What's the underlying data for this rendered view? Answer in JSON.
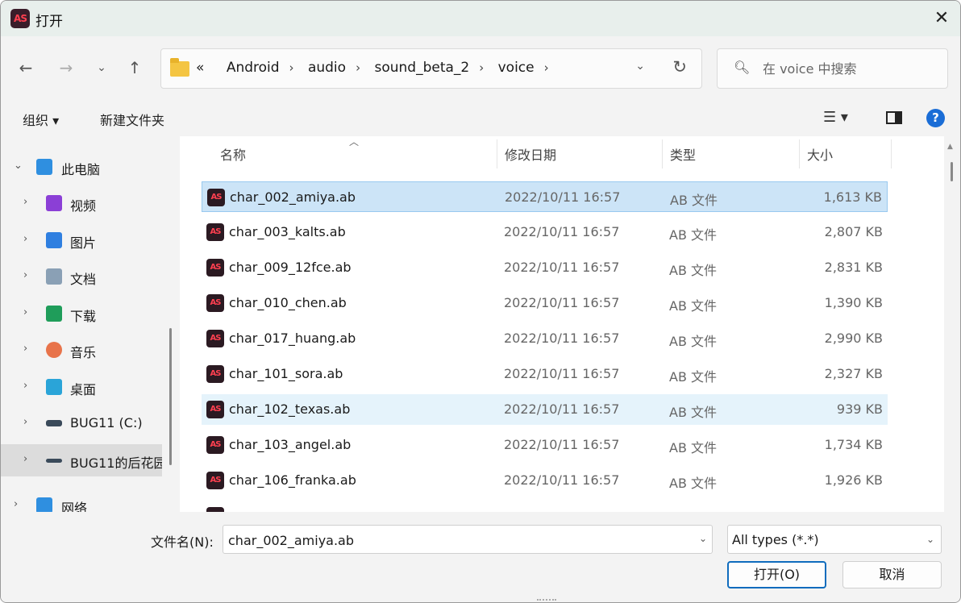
{
  "window": {
    "title": "打开",
    "app_icon_text": "AS",
    "close_glyph": "✕"
  },
  "address": {
    "crumbs": [
      "Android",
      "audio",
      "sound_beta_2",
      "voice"
    ],
    "overflow": "«",
    "separator": "›"
  },
  "search": {
    "placeholder": "在 voice 中搜索"
  },
  "toolbar": {
    "organize": "组织 ▾",
    "new_folder": "新建文件夹"
  },
  "sidebar": {
    "items": [
      {
        "label": "此电脑",
        "icon": "pc-icon",
        "color": "#2f8fe0"
      },
      {
        "label": "视频",
        "icon": "video-icon",
        "color": "#8b3fd6"
      },
      {
        "label": "图片",
        "icon": "pictures-icon",
        "color": "#2f7fe0"
      },
      {
        "label": "文档",
        "icon": "documents-icon",
        "color": "#8aa0b5"
      },
      {
        "label": "下载",
        "icon": "downloads-icon",
        "color": "#1f9d5a"
      },
      {
        "label": "音乐",
        "icon": "music-icon",
        "color": "#e8734a"
      },
      {
        "label": "桌面",
        "icon": "desktop-icon",
        "color": "#2aa4d8"
      },
      {
        "label": "BUG11 (C:)",
        "icon": "drive-icon",
        "color": "#3a4a5a"
      },
      {
        "label": "BUG11的后花园",
        "icon": "drive-icon",
        "color": "#3a4a5a"
      },
      {
        "label": "网络",
        "icon": "network-icon",
        "color": "#2f8fe0"
      }
    ]
  },
  "columns": {
    "name": "名称",
    "date": "修改日期",
    "type": "类型",
    "size": "大小"
  },
  "files": [
    {
      "name": "char_002_amiya.ab",
      "date": "2022/10/11 16:57",
      "type": "AB 文件",
      "size": "1,613 KB"
    },
    {
      "name": "char_003_kalts.ab",
      "date": "2022/10/11 16:57",
      "type": "AB 文件",
      "size": "2,807 KB"
    },
    {
      "name": "char_009_12fce.ab",
      "date": "2022/10/11 16:57",
      "type": "AB 文件",
      "size": "2,831 KB"
    },
    {
      "name": "char_010_chen.ab",
      "date": "2022/10/11 16:57",
      "type": "AB 文件",
      "size": "1,390 KB"
    },
    {
      "name": "char_017_huang.ab",
      "date": "2022/10/11 16:57",
      "type": "AB 文件",
      "size": "2,990 KB"
    },
    {
      "name": "char_101_sora.ab",
      "date": "2022/10/11 16:57",
      "type": "AB 文件",
      "size": "2,327 KB"
    },
    {
      "name": "char_102_texas.ab",
      "date": "2022/10/11 16:57",
      "type": "AB 文件",
      "size": "939 KB"
    },
    {
      "name": "char_103_angel.ab",
      "date": "2022/10/11 16:57",
      "type": "AB 文件",
      "size": "1,734 KB"
    },
    {
      "name": "char_106_franka.ab",
      "date": "2022/10/11 16:57",
      "type": "AB 文件",
      "size": "1,926 KB"
    }
  ],
  "footer": {
    "filename_label": "文件名(N):",
    "filename_value": "char_002_amiya.ab",
    "filetype_value": "All types (*.*)",
    "open_button": "打开(O)",
    "cancel_button": "取消"
  }
}
